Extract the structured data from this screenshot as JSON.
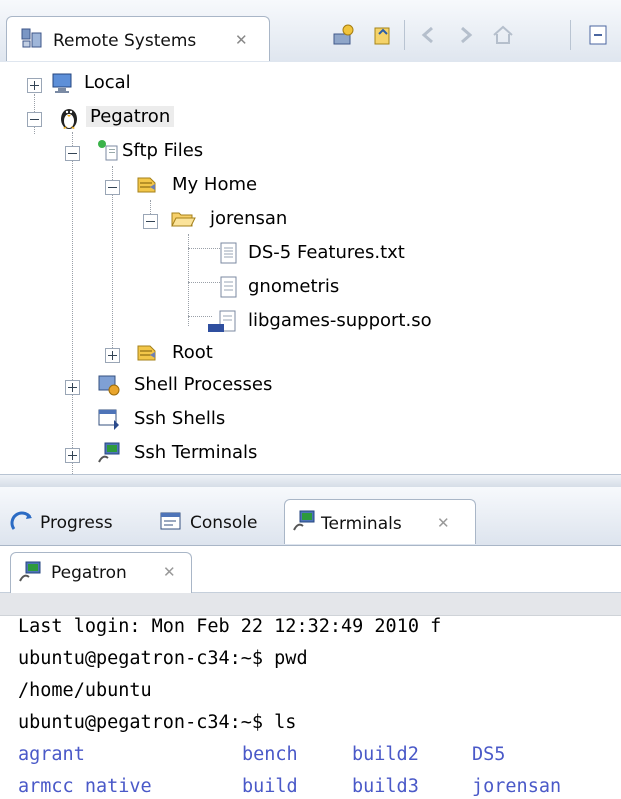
{
  "top_view": {
    "tab_label": "Remote Systems",
    "tab_close": "✕"
  },
  "tree": {
    "local": "Local",
    "pegatron": "Pegatron",
    "sftp_files": "Sftp Files",
    "my_home": "My Home",
    "jorensan": "jorensan",
    "file1": "DS-5 Features.txt",
    "file2": "gnometris",
    "file3": "libgames-support.so",
    "root": "Root",
    "shell_processes": "Shell Processes",
    "ssh_shells": "Ssh Shells",
    "ssh_terminals": "Ssh Terminals"
  },
  "bottom_tabs": {
    "progress": "Progress",
    "console": "Console",
    "terminals": "Terminals",
    "terminals_close": "✕"
  },
  "session": {
    "label": "Pegatron",
    "close": "✕"
  },
  "terminal": {
    "line1": "Last login: Mon Feb 22 12:32:49 2010 f",
    "line2": "ubuntu@pegatron-c34:~$ pwd",
    "line3": "/home/ubuntu",
    "line4": "ubuntu@pegatron-c34:~$ ls",
    "ls_row1": [
      "agrant",
      "bench",
      "build2",
      "DS5"
    ],
    "ls_row2": [
      "armcc native",
      "build",
      "build3",
      "jorensan"
    ]
  },
  "colors": {
    "ls_dir": "#4a59c8",
    "ls_file": "#2d3a8c"
  }
}
